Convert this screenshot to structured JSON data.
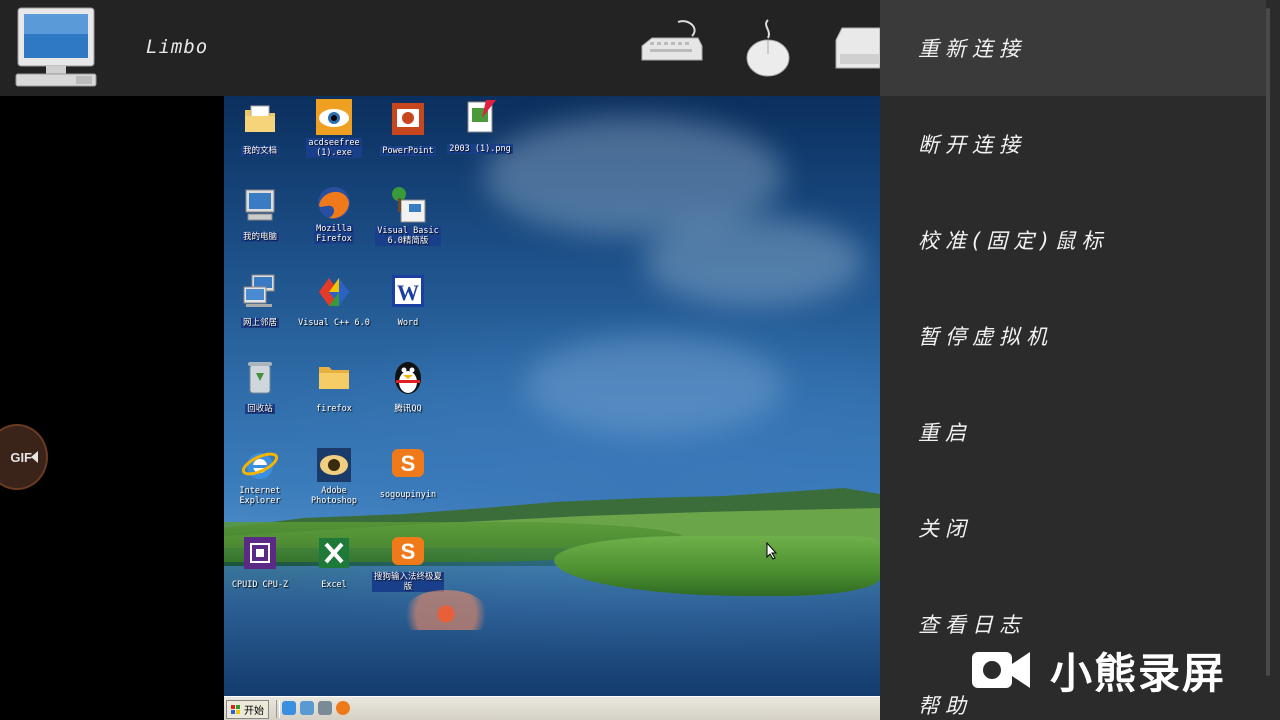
{
  "app": {
    "title": "Limbo"
  },
  "toolbar": {
    "keyboard_icon": "keyboard-icon",
    "mouse_icon": "mouse-icon",
    "drive_icon": "drive-icon"
  },
  "gif_badge": {
    "label": "GIF"
  },
  "desktop": {
    "icons": [
      {
        "label": "我的文档"
      },
      {
        "label": "acdseefree\n(1).exe"
      },
      {
        "label": "PowerPoint"
      },
      {
        "label": "2003 (1).png"
      },
      {
        "label": "我的电脑"
      },
      {
        "label": "Mozilla\nFirefox"
      },
      {
        "label": "Visual Basic\n6.0精简版"
      },
      {
        "label": "网上邻居"
      },
      {
        "label": "Visual C++ 6.0"
      },
      {
        "label": "Word"
      },
      {
        "label": "回收站"
      },
      {
        "label": "firefox"
      },
      {
        "label": "腾讯QQ"
      },
      {
        "label": "Internet\nExplorer"
      },
      {
        "label": "Adobe\nPhotoshop"
      },
      {
        "label": "sogoupinyin"
      },
      {
        "label": "CPUID CPU-Z"
      },
      {
        "label": "Excel"
      },
      {
        "label": "搜狗输入法终极夏\n版"
      }
    ],
    "taskbar": {
      "start_label": "开始"
    }
  },
  "menu": {
    "items": [
      {
        "label": "重新连接"
      },
      {
        "label": "断开连接"
      },
      {
        "label": "校准(固定)鼠标"
      },
      {
        "label": "暂停虚拟机"
      },
      {
        "label": "重启"
      },
      {
        "label": "关闭"
      },
      {
        "label": "查看日志"
      },
      {
        "label": "帮助"
      }
    ]
  },
  "watermark": {
    "text": "小熊录屏"
  }
}
